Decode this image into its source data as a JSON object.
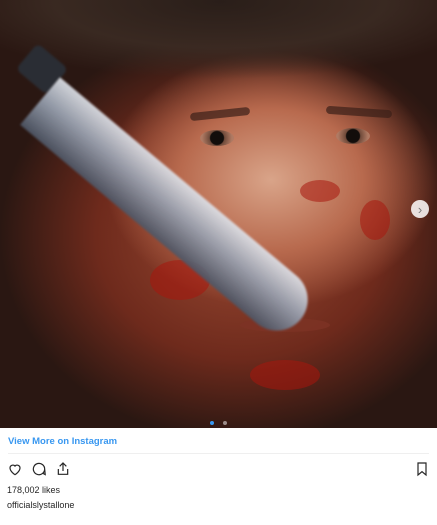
{
  "post": {
    "view_more_label": "View More on Instagram",
    "likes_text": "178,002 likes",
    "username": "officialslystallone",
    "carousel": {
      "slide_count": 2,
      "active_index": 0
    }
  },
  "icons": {
    "like": "heart-icon",
    "comment": "comment-icon",
    "share": "share-icon",
    "save": "bookmark-icon",
    "next": "chevron-right-icon"
  },
  "colors": {
    "link_blue": "#3897f0",
    "text": "#262626",
    "divider": "#efefef"
  }
}
